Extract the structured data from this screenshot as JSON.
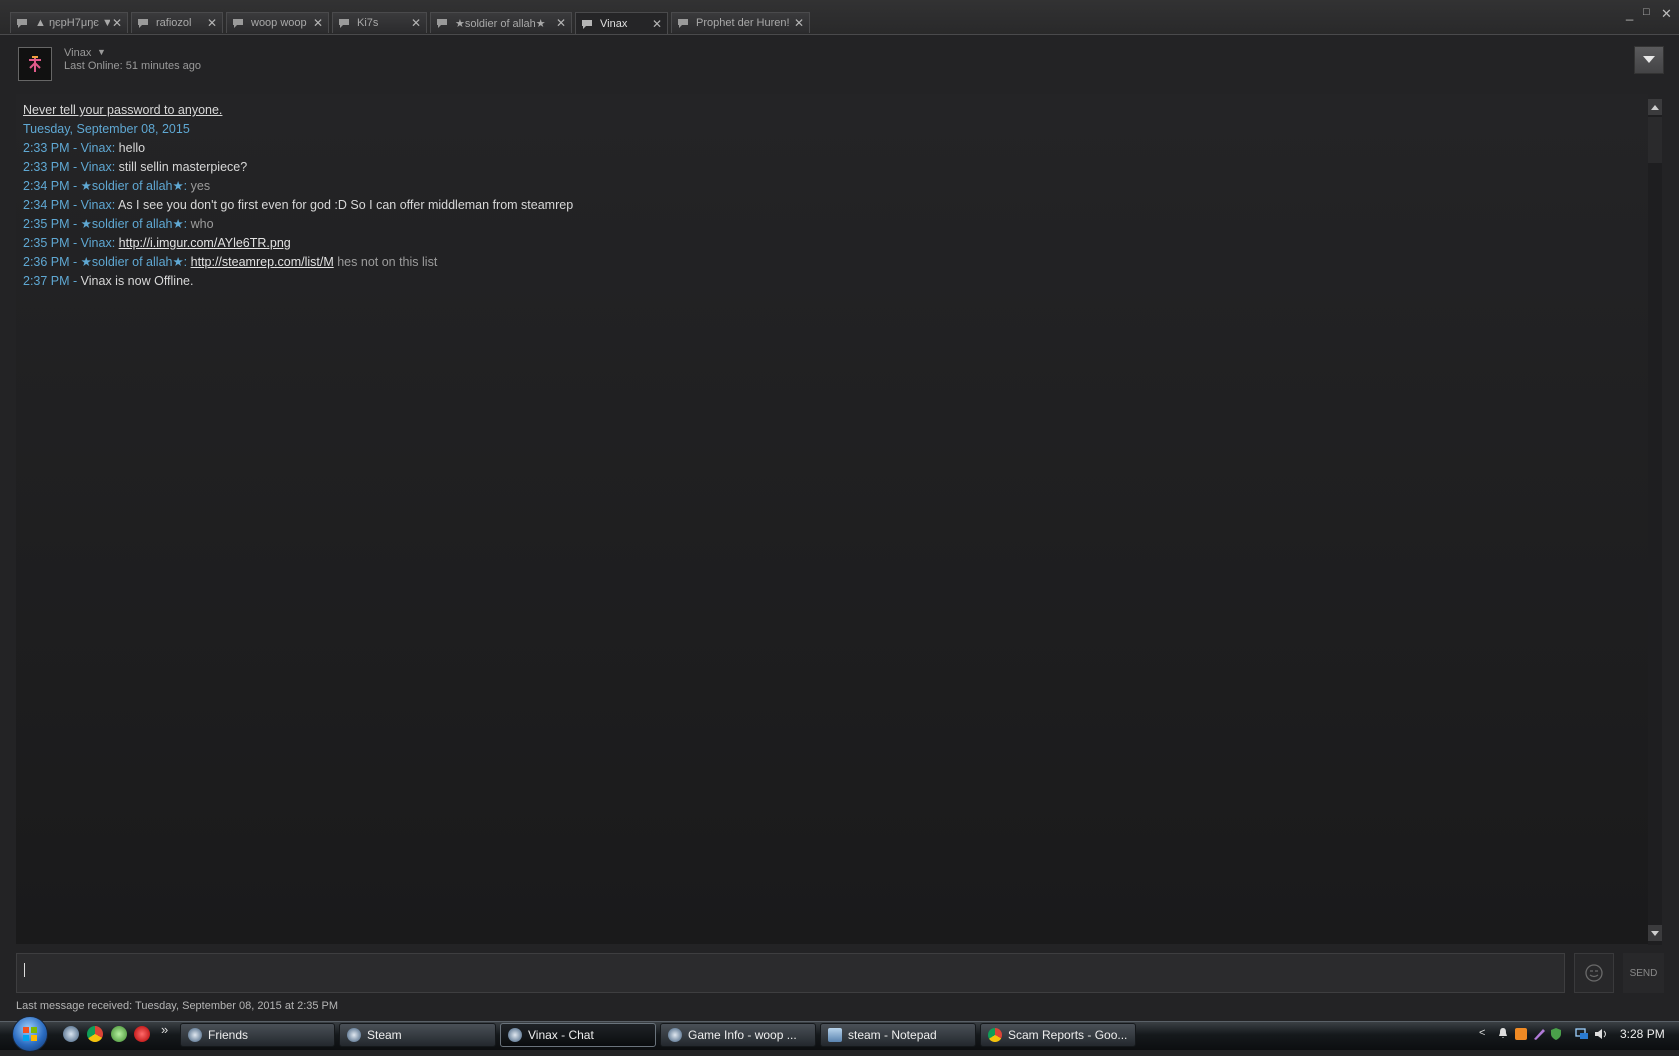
{
  "tabs": [
    {
      "label": "▲ ŋєрΗ7μŋє ▼",
      "active": false
    },
    {
      "label": "rafiozol",
      "active": false
    },
    {
      "label": "woop woop",
      "active": false
    },
    {
      "label": "Ki7s",
      "active": false
    },
    {
      "label": "★soldier of allah★",
      "active": false
    },
    {
      "label": "Vinax",
      "active": true
    },
    {
      "label": "Prophet der Huren!",
      "active": false
    }
  ],
  "window_controls": {
    "minimize": "_",
    "restore": "□",
    "close": "✕"
  },
  "header": {
    "name": "Vinax",
    "dropdown": "▼",
    "status": "Last Online: 51 minutes ago",
    "menu_button": "▼"
  },
  "chat": {
    "warning": "Never tell your password to anyone.",
    "date": "Tuesday, September 08, 2015",
    "messages": [
      {
        "prefix": "2:33 PM - Vinax:",
        "text": "hello",
        "style": "msg"
      },
      {
        "prefix": "2:33 PM - Vinax:",
        "text": "still sellin masterpiece?",
        "style": "msg"
      },
      {
        "prefix": "2:34 PM - ★soldier of allah★:",
        "text": "yes",
        "style": "msg2"
      },
      {
        "prefix": "2:34 PM - Vinax:",
        "text": "As I see you don't go first even for god :D So I can offer middleman from steamrep",
        "style": "msg"
      },
      {
        "prefix": "2:35 PM - ★soldier of allah★:",
        "text": "who",
        "style": "msg2"
      },
      {
        "prefix": "2:35 PM - Vinax:",
        "link": "http://i.imgur.com/AYle6TR.png",
        "text": "",
        "style": "msg"
      },
      {
        "prefix": "2:36 PM - ★soldier of allah★:",
        "link": "http://steamrep.com/list/M",
        "text": "hes not on this list",
        "style": "msg2"
      },
      {
        "prefix": "2:37 PM -",
        "text": "Vinax is now Offline.",
        "style": "msg"
      }
    ]
  },
  "input": {
    "value": "",
    "send_label": "SEND"
  },
  "footer": {
    "last_message": "Last message received: Tuesday, September 08, 2015 at 2:35 PM"
  },
  "taskbar": {
    "buttons": [
      {
        "label": "Friends",
        "icon": "steam-icon",
        "active": false
      },
      {
        "label": "Steam",
        "icon": "steam-icon",
        "active": false
      },
      {
        "label": "Vinax - Chat",
        "icon": "steam-icon",
        "active": true
      },
      {
        "label": "Game Info - woop ...",
        "icon": "steam-icon",
        "active": false
      },
      {
        "label": "steam - Notepad",
        "icon": "notepad-icon",
        "active": false
      },
      {
        "label": "Scam Reports - Goo...",
        "icon": "chrome-icon",
        "active": false
      }
    ],
    "quicklaunch_more": "»",
    "tray_expand": "<",
    "clock": "3:28 PM"
  },
  "colors": {
    "accent": "#5fa8d3",
    "background": "#232325",
    "text": "#d8d8d8"
  }
}
